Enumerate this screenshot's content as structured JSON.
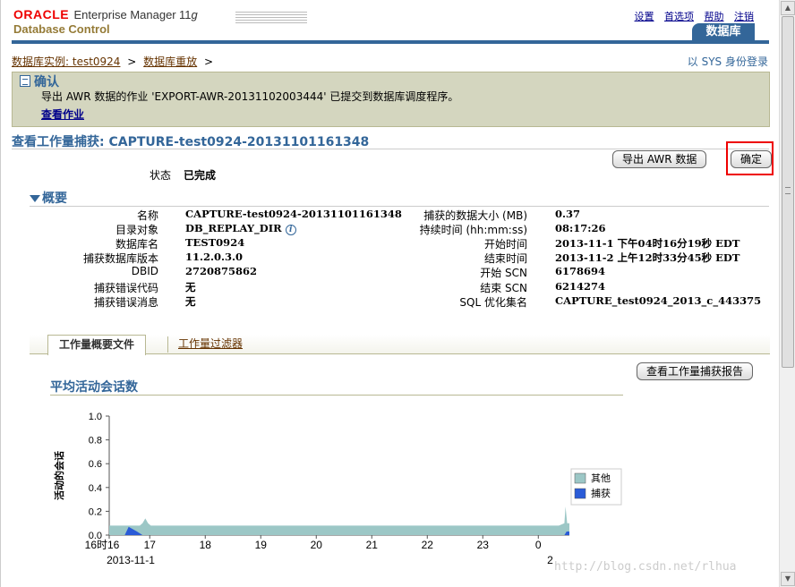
{
  "header": {
    "brand": "ORACLE",
    "product": "Enterprise Manager",
    "version_num": "11",
    "version_suffix": "g",
    "subtitle": "Database Control",
    "links": [
      "设置",
      "首选项",
      "帮助",
      "注销"
    ],
    "active_tab": "数据库"
  },
  "breadcrumb": {
    "items": [
      "数据库实例: test0924",
      "数据库重放"
    ],
    "separator": ">",
    "logged_in_as": "以 SYS 身份登录"
  },
  "confirmation": {
    "title": "确认",
    "message": "导出 AWR 数据的作业 'EXPORT-AWR-20131102003444' 已提交到数据库调度程序。",
    "link": "查看作业"
  },
  "page_title": "查看工作量捕获: CAPTURE-test0924-20131101161348",
  "buttons": {
    "export_awr": "导出 AWR 数据",
    "ok": "确定",
    "view_report": "查看工作量捕获报告"
  },
  "status": {
    "label": "状态",
    "value": "已完成"
  },
  "overview": {
    "heading": "概要",
    "left": [
      {
        "label": "名称",
        "value": "CAPTURE-test0924-20131101161348"
      },
      {
        "label": "目录对象",
        "value": "DB_REPLAY_DIR"
      },
      {
        "label": "数据库名",
        "value": "TEST0924"
      },
      {
        "label": "捕获数据库版本",
        "value": "11.2.0.3.0"
      },
      {
        "label": "DBID",
        "value": "2720875862"
      },
      {
        "label": "捕获错误代码",
        "value": "无"
      },
      {
        "label": "捕获错误消息",
        "value": "无"
      }
    ],
    "right": [
      {
        "label": "捕获的数据大小 (MB)",
        "value": "0.37"
      },
      {
        "label": "持续时间 (hh:mm:ss)",
        "value": "08:17:26"
      },
      {
        "label": "开始时间",
        "value": "2013-11-1 下午04时16分19秒 EDT"
      },
      {
        "label": "结束时间",
        "value": "2013-11-2 上午12时33分45秒 EDT"
      },
      {
        "label": "开始 SCN",
        "value": "6178694"
      },
      {
        "label": "结束 SCN",
        "value": "6214274"
      },
      {
        "label": "SQL 优化集名",
        "value": "CAPTURE_test0924_2013_c_443375"
      }
    ],
    "info_icon": "info-icon"
  },
  "tabs": {
    "active": "工作量概要文件",
    "other": "工作量过滤器"
  },
  "chart_title": "平均活动会话数",
  "chart_data": {
    "type": "area",
    "ylabel": "活动的会话",
    "ylim": [
      0,
      1.0
    ],
    "yticks": [
      "0.0",
      "0.2",
      "0.4",
      "0.6",
      "0.8",
      "1.0"
    ],
    "xticks": [
      "16时16",
      "17",
      "18",
      "19",
      "20",
      "21",
      "22",
      "23",
      "0"
    ],
    "xsubticks": [
      "2013-11-1",
      "2"
    ],
    "x_hours": [
      0,
      0.73,
      1.73,
      2.73,
      3.73,
      4.73,
      5.73,
      6.73,
      7.73
    ],
    "legend": [
      "其他",
      "捕获"
    ],
    "legend_position": "right",
    "series": [
      {
        "name": "其他",
        "color": "#9cc7c6",
        "x": [
          0,
          0.3,
          0.55,
          0.6,
          0.65,
          0.7,
          0.75,
          0.8,
          1.0,
          2.0,
          3.0,
          4.0,
          5.0,
          6.0,
          7.0,
          8.0,
          8.1,
          8.2,
          8.22,
          8.25,
          8.29
        ],
        "values": [
          0.08,
          0.08,
          0.08,
          0.1,
          0.14,
          0.1,
          0.08,
          0.08,
          0.08,
          0.08,
          0.08,
          0.08,
          0.08,
          0.08,
          0.08,
          0.08,
          0.08,
          0.1,
          0.24,
          0.1,
          0.1
        ]
      },
      {
        "name": "捕获",
        "color": "#2a5bd7",
        "x": [
          0,
          0.28,
          0.35,
          0.5,
          0.6,
          8.2,
          8.24,
          8.29
        ],
        "values": [
          0,
          0,
          0.07,
          0.03,
          0,
          0,
          0.03,
          0.03
        ]
      }
    ]
  },
  "watermark": "http://blog.csdn.net/rlhua"
}
